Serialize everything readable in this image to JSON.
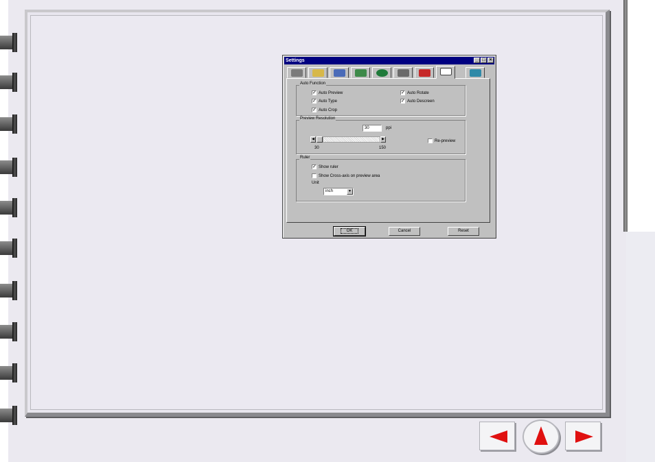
{
  "dialog": {
    "title": "Settings",
    "tabs": [
      {
        "icon": "scanner-icon",
        "color": "#7a7a7a"
      },
      {
        "icon": "folder-photo-icon",
        "color": "#d7b84a"
      },
      {
        "icon": "film-icon",
        "color": "#4a6bb8"
      },
      {
        "icon": "image-adjust-icon",
        "color": "#3e8a4a"
      },
      {
        "icon": "color-wheel-icon",
        "color": "#1f7a3a"
      },
      {
        "icon": "gears-icon",
        "color": "#6a6a6a"
      },
      {
        "icon": "memory-card-icon",
        "color": "#c62828"
      },
      {
        "icon": "layout-icon",
        "color": "#404040",
        "active": true
      },
      {
        "icon": "scan-bed-icon",
        "color": "#2f8aa8"
      }
    ],
    "auto_function": {
      "title": "Auto Function",
      "auto_preview": "Auto Preview",
      "auto_type": "Auto Type",
      "auto_crop": "Auto Crop",
      "auto_rotate": "Auto Rotate",
      "auto_descreen": "Auto Descreen"
    },
    "preview_resolution": {
      "title": "Preview Resolution",
      "value": "30",
      "unit": "ppi",
      "min_label": "30",
      "max_label": "150",
      "repreview": "Re-preview"
    },
    "ruler": {
      "title": "Ruler",
      "show_ruler": "Show ruler",
      "show_crossaxis": "Show Cross-axis on preview area",
      "unit_label": "Unit",
      "unit_value": "inch"
    },
    "buttons": {
      "ok": "OK",
      "cancel": "Cancel",
      "reset": "Reset"
    }
  },
  "colors": {
    "nav_arrow": "#e01010",
    "titlebar": "#000080"
  }
}
